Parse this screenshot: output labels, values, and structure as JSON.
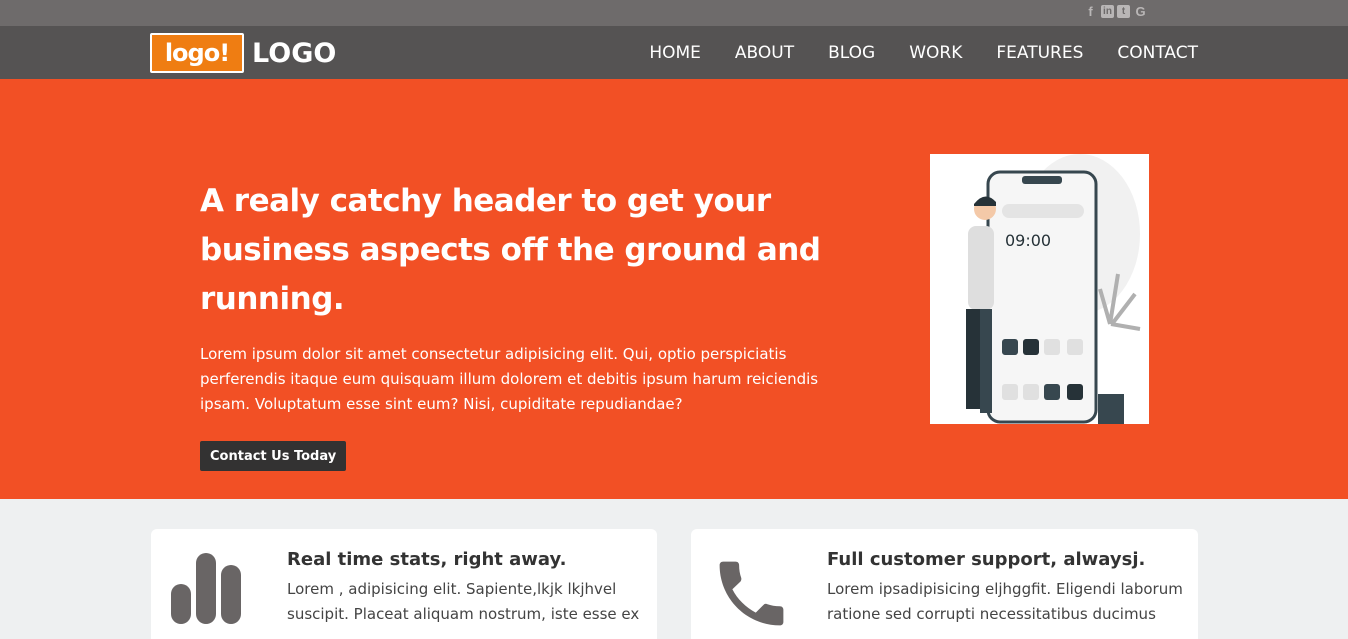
{
  "social": {
    "facebook": "f",
    "linkedin": "in",
    "twitter": "t",
    "google": "G"
  },
  "brand": {
    "badge": "logo!",
    "name": "LOGO"
  },
  "nav": [
    "HOME",
    "ABOUT",
    "BLOG",
    "WORK",
    "FEATURES",
    "CONTACT"
  ],
  "hero": {
    "title": "A realy catchy header to get your business aspects off the ground and running.",
    "body": "Lorem ipsum dolor sit amet consectetur adipisicing elit. Qui, optio perspiciatis perferendis itaque eum quisquam illum dolorem et debitis ipsum harum reiciendis ipsam. Voluptatum esse sint eum? Nisi, cupiditate repudiandae?",
    "cta": "Contact Us Today",
    "phone_time": "09:00"
  },
  "features": [
    {
      "title": "Real time stats, right away.",
      "text": "Lorem , adipisicing elit. Sapiente,lkjk lkjhvel suscipit. Placeat aliquam nostrum, iste esse ex"
    },
    {
      "title": "Full customer support, alwaysj.",
      "text": "Lorem ipsadipisicing eljhggfit. Eligendi laborum ratione sed corrupti necessitatibus ducimus"
    }
  ],
  "colors": {
    "accent": "#f25025",
    "nav_bg": "#555353",
    "topbar_bg": "#6e6b6b",
    "logo_orange": "#ef7d12"
  }
}
